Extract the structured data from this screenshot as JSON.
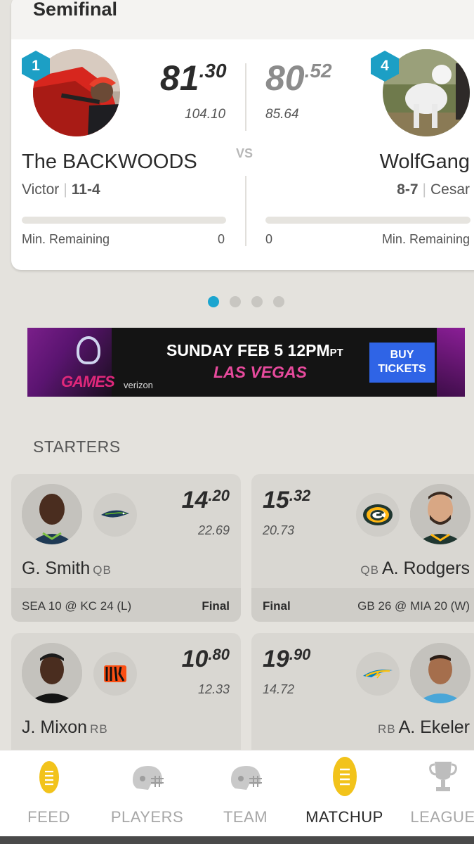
{
  "matchup": {
    "round": "Semifinal",
    "vs_label": "VS",
    "home": {
      "seed": "1",
      "score_int": "81",
      "score_dec": ".30",
      "projected": "104.10",
      "team_name": "The BACKWOODS",
      "owner": "Victor",
      "record": "11-4",
      "min_label": "Min. Remaining",
      "min_value": "0",
      "progress": 0
    },
    "away": {
      "seed": "4",
      "score_int": "80",
      "score_dec": ".52",
      "projected": "85.64",
      "team_name": "WolfGang",
      "owner": "Cesar",
      "record": "8-7",
      "min_label": "Min. Remaining",
      "min_value": "0",
      "progress": 0
    }
  },
  "carousel": {
    "page_count": 4,
    "active_index": 0
  },
  "ad": {
    "brand_text": "GAMES",
    "sponsor": "verizon",
    "headline_main": "SUNDAY FEB 5 12PM",
    "headline_suffix": "PT",
    "location": "LAS VEGAS",
    "cta": "BUY TICKETS"
  },
  "starters": {
    "label": "STARTERS",
    "rows": [
      {
        "left": {
          "name": "G. Smith",
          "pos": "QB",
          "team_logo": "seahawks-logo-icon",
          "pts_int": "14",
          "pts_dec": ".20",
          "projected": "22.69",
          "game": "SEA 10 @ KC 24 (L)",
          "status": "Final"
        },
        "right": {
          "name": "A. Rodgers",
          "pos": "QB",
          "team_logo": "packers-logo-icon",
          "pts_int": "15",
          "pts_dec": ".32",
          "projected": "20.73",
          "game": "GB 26 @ MIA 20 (W)",
          "status": "Final"
        }
      },
      {
        "left": {
          "name": "J. Mixon",
          "pos": "RB",
          "team_logo": "bengals-logo-icon",
          "pts_int": "10",
          "pts_dec": ".80",
          "projected": "12.33"
        },
        "right": {
          "name": "A. Ekeler",
          "pos": "RB",
          "team_logo": "chargers-logo-icon",
          "pts_int": "19",
          "pts_dec": ".90",
          "projected": "14.72"
        }
      }
    ]
  },
  "nav": {
    "items": [
      {
        "label": "FEED",
        "icon": "football-icon",
        "active": false
      },
      {
        "label": "PLAYERS",
        "icon": "helmet-icon",
        "active": false
      },
      {
        "label": "TEAM",
        "icon": "helmet-icon",
        "active": false
      },
      {
        "label": "MATCHUP",
        "icon": "football-icon",
        "active": true
      },
      {
        "label": "LEAGUE",
        "icon": "trophy-icon",
        "active": false
      }
    ]
  },
  "colors": {
    "accent": "#1ca5cf",
    "football_gold": "#f2c31b",
    "background": "#e4e2dd"
  }
}
